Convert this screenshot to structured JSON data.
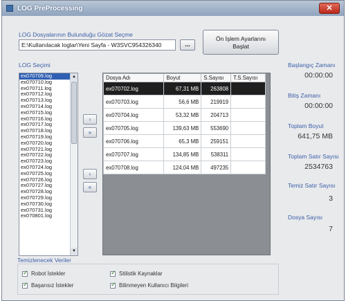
{
  "window": {
    "title": "LOG PreProcessing",
    "close_glyph": "✕"
  },
  "path_section": {
    "label": "LOG Dosyalarının Bulunduğu Gözat Seçme",
    "path_value": "E:\\Kullanılacak loglar\\Yeni Sayfa - W3SVC954326340",
    "browse_label": "...",
    "settings_button_line1": "Ön İşlem Ayarlarını",
    "settings_button_line2": "Başlat"
  },
  "log_list": {
    "label": "LOG Seçimi",
    "items": [
      "ex070709.log",
      "ex070710.log",
      "ex070711.log",
      "ex070712.log",
      "ex070713.log",
      "ex070714.log",
      "ex070715.log",
      "ex070716.log",
      "ex070717.log",
      "ex070718.log",
      "ex070719.log",
      "ex070720.log",
      "ex070721.log",
      "ex070722.log",
      "ex070723.log",
      "ex070724.log",
      "ex070725.log",
      "ex070726.log",
      "ex070727.log",
      "ex070728.log",
      "ex070729.log",
      "ex070730.log",
      "ex070731.log",
      "ex070801.log"
    ],
    "selected_index": 0
  },
  "move_buttons": [
    "›",
    "»",
    "‹",
    "«"
  ],
  "grid": {
    "columns": [
      "Dosya Adı",
      "Boyut",
      "S.Sayısı",
      "T.S.Sayısı"
    ],
    "rows": [
      [
        "ex070702.log",
        "67,31 MB",
        "263808",
        ""
      ],
      [
        "ex070703.log",
        "56,6 MB",
        "219919",
        ""
      ],
      [
        "ex070704.log",
        "53,32 MB",
        "204713",
        ""
      ],
      [
        "ex070705.log",
        "139,63 MB",
        "553690",
        ""
      ],
      [
        "ex070706.log",
        "65,3 MB",
        "259151",
        ""
      ],
      [
        "ex070707.log",
        "134,85 MB",
        "538311",
        ""
      ],
      [
        "ex070708.log",
        "124,04 MB",
        "497235",
        ""
      ]
    ],
    "selected_row": 0
  },
  "side_panel": {
    "start_time_label": "Başlangıç Zamanı",
    "start_time_value": "00:00:00",
    "end_time_label": "Bitiş Zamanı",
    "end_time_value": "00:00:00",
    "total_size_label": "Toplam Boyut",
    "total_size_value": "641,75 MB",
    "total_lines_label": "Toplam Satır Sayısı",
    "total_lines_value": "2534763",
    "clean_lines_label": "Temiz Satır Sayısı",
    "clean_lines_value": "3",
    "file_count_label": "Dosya Sayısı",
    "file_count_value": "7"
  },
  "options": {
    "label": "Temizlenecek Veriler",
    "items": [
      "Robot İstekler",
      "Başarısız İstekler",
      "Stilistik Kaynaklar",
      "Bilinmeyen Kullanıcı Bilgileri"
    ]
  }
}
